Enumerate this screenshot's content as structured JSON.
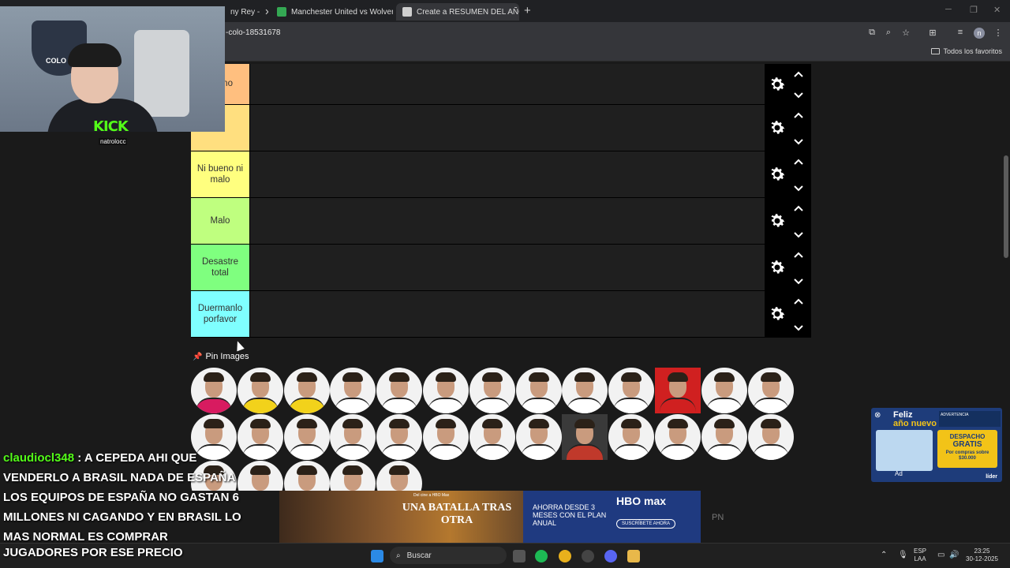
{
  "browser": {
    "tabs": [
      {
        "label": "ny Rey -",
        "close": "✕",
        "favicon_color": "#2a2a2a"
      },
      {
        "label": "Manchester United vs Wolverh",
        "close": "✕",
        "favicon_color": "#34a853"
      },
      {
        "label": "Create a RESUMEN DEL AÑO C",
        "close": "✕",
        "favicon_color": "#cfcfcf"
      }
    ],
    "new_tab": "+",
    "url": "-colo-18531678",
    "bookmarks_label": "Todos los favoritos",
    "profile_initial": "n"
  },
  "tier_list": {
    "tiers": [
      {
        "label": "bueno",
        "color": "#ffbf7f"
      },
      {
        "label": "no",
        "color": "#ffdf7f"
      },
      {
        "label": "Ni bueno ni malo",
        "color": "#ffff7f"
      },
      {
        "label": "Malo",
        "color": "#bfff7f"
      },
      {
        "label": "Desastre total",
        "color": "#7fff7f"
      },
      {
        "label": "Duermanlo porfavor",
        "color": "#7fffff"
      }
    ],
    "pin_images": "Pin Images",
    "pool_count": 31
  },
  "stream": {
    "crest_text": "COLO CO",
    "kick_logo": "KICK",
    "kick_user": "natrolocc",
    "chat": {
      "username": "claudiocl348",
      "lines": [
        " : A CEPEDA AHI QUE",
        "VENDERLO A BRASIL NADA DE ESPAÑA",
        "LOS EQUIPOS DE ESPAÑA NO GASTAN 6",
        "MILLONES NI CAGANDO Y EN BRASIL LO",
        "MAS NORMAL ES COMPRAR",
        "JUGADORES POR ESE PRECIO"
      ]
    }
  },
  "ads": {
    "side": {
      "feliz": "Feliz",
      "ano_nuevo": "año nuevo",
      "warning": "ADVERTENCIA",
      "despacho": "DESPACHO",
      "gratis": "GRATIS",
      "compras": "Por compras sobre $30.000",
      "ad_label": "Ad",
      "brand": "líder"
    },
    "banner": {
      "top_text": "Del cine a HBO Max",
      "title": "UNA BATALLA TRAS OTRA",
      "offer": "AHORRA DESDE 3 MESES CON EL PLAN ANUAL",
      "brand": "HBO max",
      "cta": "SUSCRÍBETE AHORA"
    },
    "pn": "PN"
  },
  "taskbar": {
    "search_placeholder": "Buscar",
    "lang_top": "ESP",
    "lang_bottom": "LAA",
    "time": "23:25",
    "date": "30-12-2025"
  }
}
